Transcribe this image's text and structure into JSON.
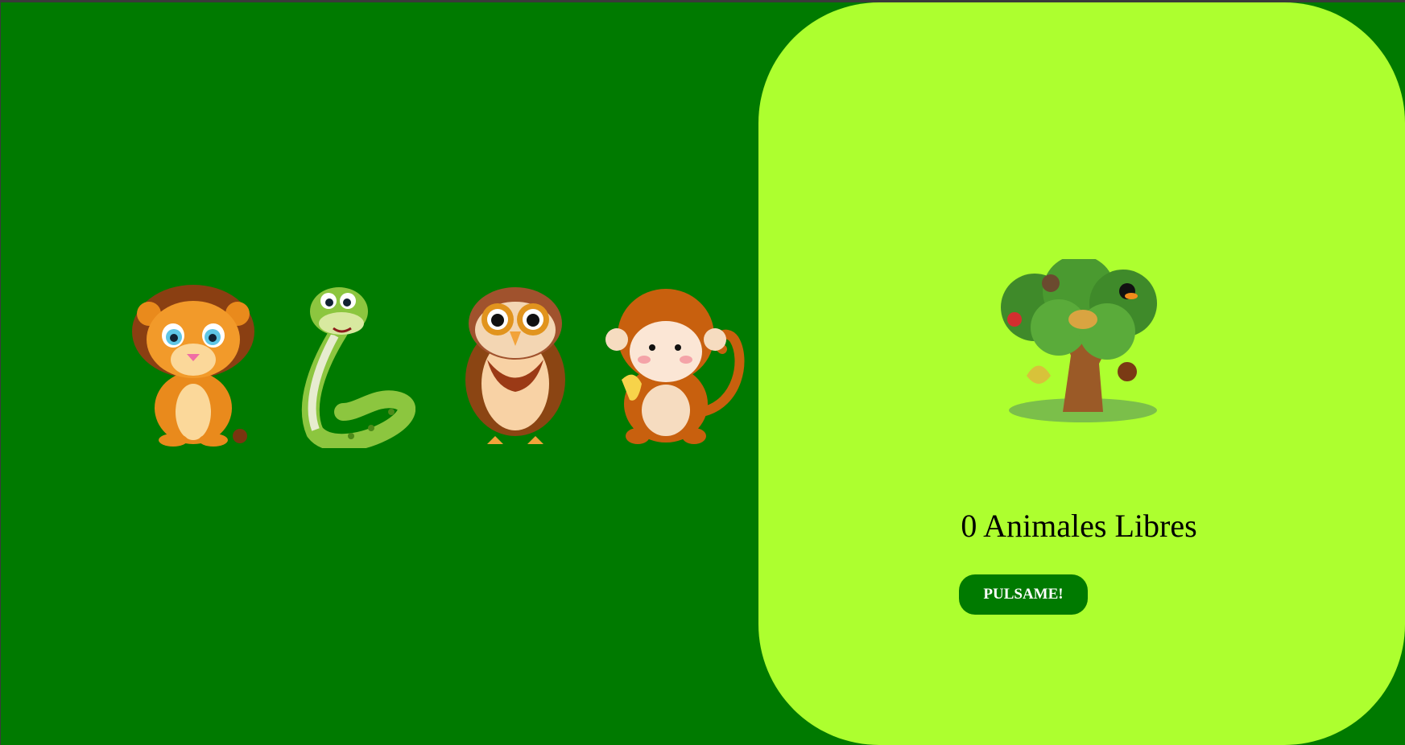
{
  "page": {
    "background_color": "#007a00",
    "panel_color": "#adff2f",
    "button_color": "#007a00"
  },
  "animals": [
    {
      "name": "lion-icon"
    },
    {
      "name": "snake-icon"
    },
    {
      "name": "owl-icon"
    },
    {
      "name": "monkey-icon"
    }
  ],
  "tree": {
    "name": "tree-with-animals-icon"
  },
  "counter": {
    "text": "0 Animales Libres"
  },
  "button": {
    "label": "PULSAME!"
  }
}
